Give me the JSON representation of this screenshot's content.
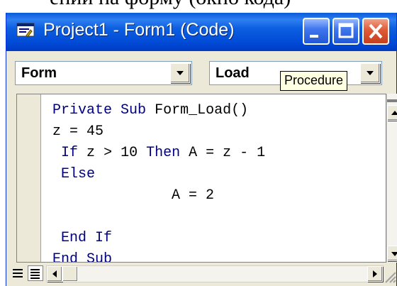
{
  "background_text": "ении на форму (окно кода)",
  "window": {
    "title": "Project1 - Form1 (Code)",
    "buttons": [
      "minimize",
      "maximize",
      "close"
    ]
  },
  "combos": {
    "object": "Form",
    "procedure": "Load"
  },
  "tooltip": "Procedure",
  "code_lines": [
    "Private Sub Form_Load()",
    "z = 45",
    " If z > 10 Then A = z - 1",
    " Else",
    "              A = 2",
    "",
    " End If",
    "End Sub"
  ],
  "colors": {
    "titlebar": "#0a5bd9",
    "keyword": "#000080",
    "tooltip_bg": "#ffffe1"
  }
}
